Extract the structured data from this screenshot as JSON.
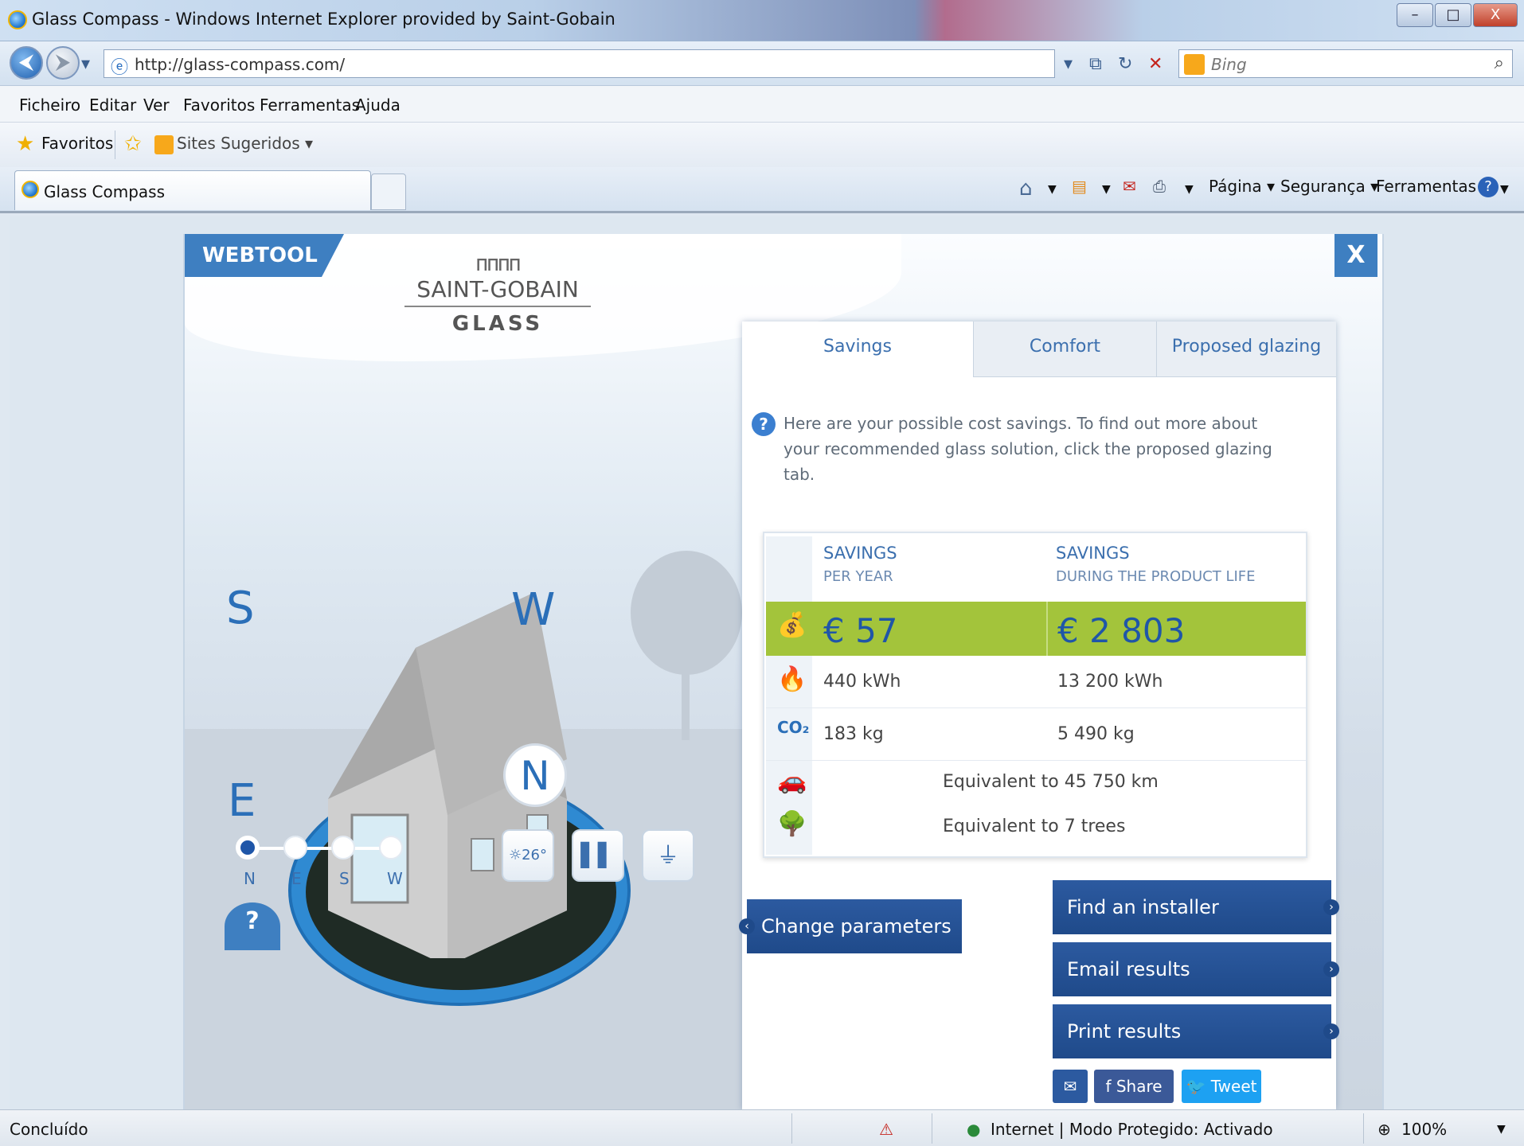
{
  "window": {
    "title": "Glass Compass - Windows Internet Explorer provided by Saint-Gobain",
    "controls": {
      "minimize": "–",
      "maximize": "□",
      "close": "X"
    }
  },
  "address": {
    "url": "http://glass-compass.com/",
    "search_placeholder": "Bing"
  },
  "menu": [
    "Ficheiro",
    "Editar",
    "Ver",
    "Favoritos",
    "Ferramentas",
    "Ajuda"
  ],
  "favorites": {
    "label": "Favoritos",
    "suggested": "Sites Sugeridos ▾"
  },
  "tab": {
    "label": "Glass Compass"
  },
  "commandbar": {
    "pagina": "Página ▾",
    "seguranca": "Segurança ▾",
    "ferramentas": "Ferramentas ▾"
  },
  "app": {
    "webtool": "WEBTOOL",
    "close": "X",
    "logo": {
      "mark": "ᴨᴨᴨᴨ",
      "brand": "SAINT-GOBAIN",
      "sub": "GLASS"
    },
    "directions": {
      "s": "S",
      "w": "W",
      "e": "E",
      "n": "N"
    },
    "orientation": {
      "labels": [
        "N",
        "E",
        "S",
        "W"
      ],
      "selected": "N"
    },
    "tools": {
      "sun": "☼26°",
      "glazing": "▌▌",
      "plug": "⏚"
    },
    "help": "?"
  },
  "panel": {
    "tabs": [
      "Savings",
      "Comfort",
      "Proposed glazing"
    ],
    "active_tab": "Savings",
    "info": "Here are your possible cost savings. To find out more about your recommended glass solution, click the proposed glazing tab.",
    "info_icon": "?",
    "table": {
      "col1": {
        "title": "SAVINGS",
        "sub": "PER YEAR"
      },
      "col2": {
        "title": "SAVINGS",
        "sub": "DURING THE PRODUCT LIFE"
      },
      "money": {
        "year": "€ 57",
        "life": "€ 2 803"
      },
      "energy": {
        "year": "440 kWh",
        "life": "13 200 kWh"
      },
      "co2": {
        "year": "183 kg",
        "life": "5 490 kg"
      },
      "car": "Equivalent to 45 750 km",
      "trees": "Equivalent to 7 trees"
    },
    "buttons": {
      "find_installer": "Find an installer",
      "email_results": "Email results",
      "print_results": "Print results",
      "change_parameters": "Change parameters"
    },
    "social": {
      "share": "f  Share",
      "tweet": "Tweet"
    }
  },
  "status": {
    "left": "Concluído",
    "zone": "Internet | Modo Protegido: Activado",
    "zoom": "100%"
  }
}
